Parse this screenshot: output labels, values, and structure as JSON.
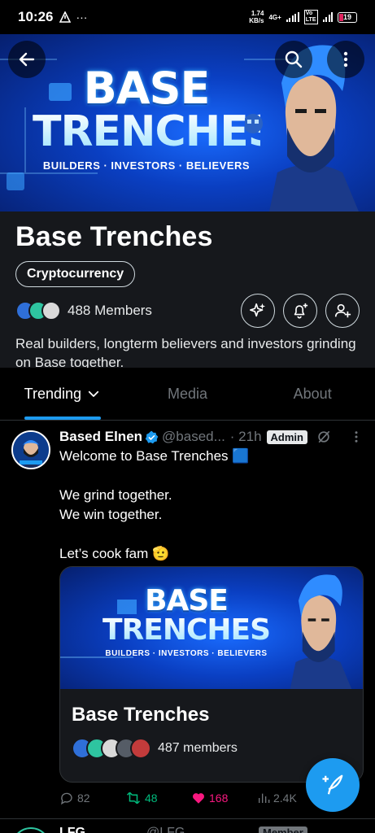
{
  "status_bar": {
    "time": "10:26",
    "net_speed_value": "1.74",
    "net_speed_unit": "KB/s",
    "network": "4G+",
    "battery": "19"
  },
  "banner": {
    "title_line1": "BASE",
    "title_line2": "TRENCHES",
    "tagline": "BUILDERS · INVESTORS · BELIEVERS"
  },
  "group": {
    "name": "Base Trenches",
    "topic": "Cryptocurrency",
    "members_label": "488 Members",
    "description": "Real builders, longterm believers and investors grinding on Base together."
  },
  "tabs": [
    {
      "label": "Trending",
      "active": true
    },
    {
      "label": "Media",
      "active": false
    },
    {
      "label": "About",
      "active": false
    }
  ],
  "post": {
    "author": "Based Elnen",
    "handle": "@based...",
    "time": "· 21h",
    "badge": "Admin",
    "text": "Welcome to Base Trenches 🟦\n\nWe grind together.\nWe win together.\n\nLet’s cook fam 🫡",
    "card": {
      "title": "Base Trenches",
      "members_label": "487 members",
      "banner_line1": "BASE",
      "banner_line2": "TRENCHES",
      "banner_tagline": "BUILDERS · INVESTORS · BELIEVERS"
    },
    "stats": {
      "replies": "82",
      "reposts": "48",
      "likes": "168",
      "views": "2.4K"
    }
  },
  "next_post": {
    "author_partial": "LFG",
    "handle_partial": "@LFG",
    "badge_partial": "Member"
  },
  "colors": {
    "accent": "#1d9bf0",
    "repost": "#00ba7c",
    "like": "#f91880",
    "surface": "#16181c"
  }
}
